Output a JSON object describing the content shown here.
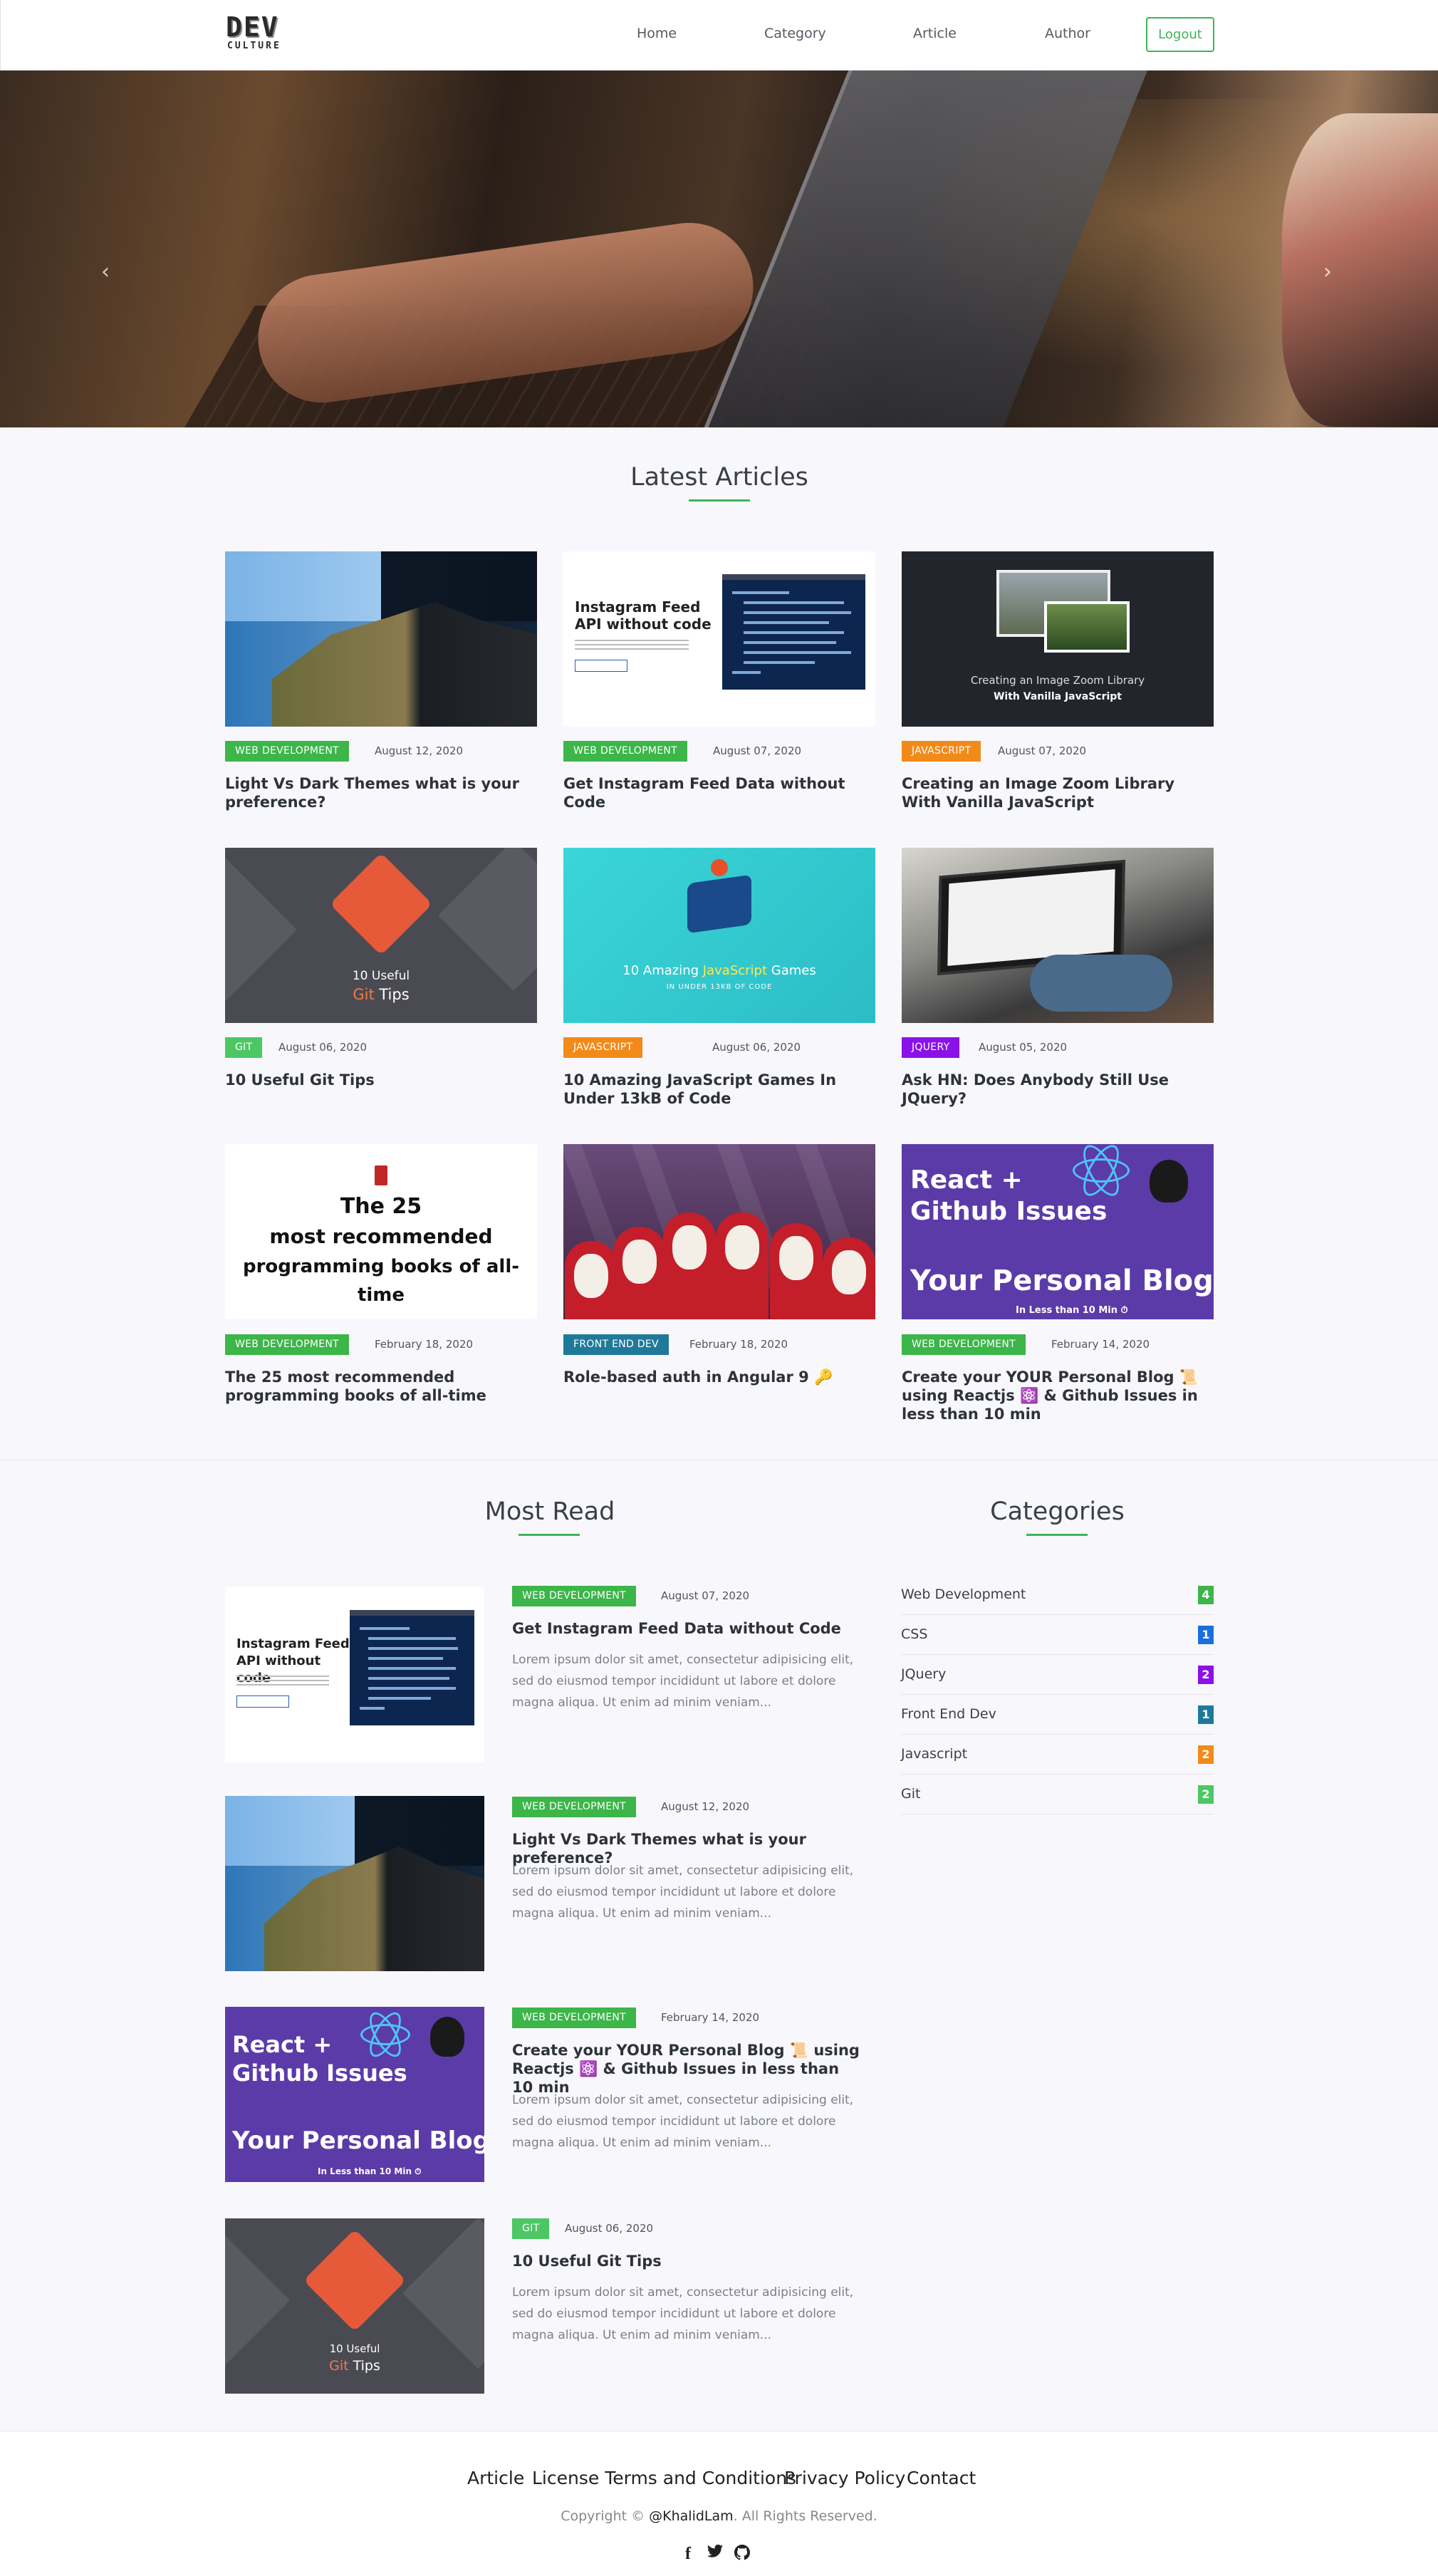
{
  "nav": {
    "logo_top": "DEV",
    "logo_bottom": "CULTURE",
    "links": [
      "Home",
      "Category",
      "Article",
      "Author"
    ],
    "logout": "Logout"
  },
  "hero": {
    "prev": "‹",
    "next": "›"
  },
  "latest": {
    "title": "Latest Articles",
    "articles": [
      {
        "badge": "WEB DEVELOPMENT",
        "badge_color": "#3cb549",
        "date": "August 12, 2020",
        "title": "Light Vs Dark Themes what is your preference?"
      },
      {
        "badge": "WEB DEVELOPMENT",
        "badge_color": "#3cb549",
        "date": "August 07, 2020",
        "title": "Get Instagram Feed Data without Code",
        "thumb_title": "Instagram Feed API without code"
      },
      {
        "badge": "JAVASCRIPT",
        "badge_color": "#f28a1a",
        "date": "August 07, 2020",
        "title": "Creating an Image Zoom Library With Vanilla JavaScript",
        "thumb_line1": "Creating an Image Zoom Library",
        "thumb_line2": "With Vanilla JavaScript"
      },
      {
        "badge": "GIT",
        "badge_color": "#4cc764",
        "date": "August 06, 2020",
        "title": "10 Useful Git Tips",
        "thumb_line1": "10 Useful",
        "thumb_line2a": "Git",
        "thumb_line2b": " Tips"
      },
      {
        "badge": "JAVASCRIPT",
        "badge_color": "#f28a1a",
        "date": "August 06, 2020",
        "title": "10 Amazing JavaScript Games In Under 13kB of Code",
        "thumb_line1a": "10 Amazing ",
        "thumb_line1b": "JavaScript",
        "thumb_line1c": " Games",
        "thumb_line2": "IN UNDER 13KB OF CODE"
      },
      {
        "badge": "JQUERY",
        "badge_color": "#8a12e8",
        "date": "August 05, 2020",
        "title": "Ask HN: Does Anybody Still Use JQuery?"
      },
      {
        "badge": "WEB DEVELOPMENT",
        "badge_color": "#3cb549",
        "date": "February 18, 2020",
        "title": "The 25 most recommended programming books of all-time",
        "thumb_line1": "The 25",
        "thumb_line2": "most recommended",
        "thumb_line3": "programming books of all-time"
      },
      {
        "badge": "FRONT END DEV",
        "badge_color": "#1f7a9a",
        "date": "February 18, 2020",
        "title": "Role-based auth in Angular 9 🔑"
      },
      {
        "badge": "WEB DEVELOPMENT",
        "badge_color": "#3cb549",
        "date": "February 14, 2020",
        "title": "Create your YOUR Personal Blog 📜 using Reactjs ⚛️ & Github Issues in less than 10 min",
        "thumb_line1": "React +",
        "thumb_line2": "Github Issues",
        "thumb_line3": "Your Personal Blog🔥",
        "thumb_line4": "In Less than 10 Min ⏱"
      }
    ]
  },
  "most_read": {
    "title": "Most Read",
    "items": [
      {
        "badge": "WEB DEVELOPMENT",
        "badge_color": "#3cb549",
        "date": "August 07, 2020",
        "title": "Get Instagram Feed Data without Code",
        "desc": "Lorem ipsum dolor sit amet, consectetur adipisicing elit, sed do eiusmod tempor incididunt ut labore et dolore magna aliqua. Ut enim ad minim veniam...",
        "thumb_title": "Instagram Feed API without code"
      },
      {
        "badge": "WEB DEVELOPMENT",
        "badge_color": "#3cb549",
        "date": "August 12, 2020",
        "title": "Light Vs Dark Themes what is your preference?",
        "desc": "Lorem ipsum dolor sit amet, consectetur adipisicing elit, sed do eiusmod tempor incididunt ut labore et dolore magna aliqua. Ut enim ad minim veniam..."
      },
      {
        "badge": "WEB DEVELOPMENT",
        "badge_color": "#3cb549",
        "date": "February 14, 2020",
        "title": "Create your YOUR Personal Blog 📜 using Reactjs ⚛️ & Github Issues in less than 10 min",
        "desc": "Lorem ipsum dolor sit amet, consectetur adipisicing elit, sed do eiusmod tempor incididunt ut labore et dolore magna aliqua. Ut enim ad minim veniam...",
        "thumb_line1": "React +",
        "thumb_line2": "Github Issues",
        "thumb_line3": "Your Personal Blog🔥",
        "thumb_line4": "In Less than 10 Min ⏱"
      },
      {
        "badge": "GIT",
        "badge_color": "#4cc764",
        "date": "August 06, 2020",
        "title": "10 Useful Git Tips",
        "desc": "Lorem ipsum dolor sit amet, consectetur adipisicing elit, sed do eiusmod tempor incididunt ut labore et dolore magna aliqua. Ut enim ad minim veniam...",
        "thumb_line1": "10 Useful",
        "thumb_line2a": "Git",
        "thumb_line2b": " Tips"
      }
    ]
  },
  "categories": {
    "title": "Categories",
    "items": [
      {
        "label": "Web Development",
        "count": "4",
        "color": "#3cb549"
      },
      {
        "label": "CSS",
        "count": "1",
        "color": "#1a6fe0"
      },
      {
        "label": "JQuery",
        "count": "2",
        "color": "#8a12e8"
      },
      {
        "label": "Front End Dev",
        "count": "1",
        "color": "#1f7a9a"
      },
      {
        "label": "Javascript",
        "count": "2",
        "color": "#f28a1a"
      },
      {
        "label": "Git",
        "count": "2",
        "color": "#4cc764"
      }
    ]
  },
  "footer": {
    "links": [
      "Article",
      "License Terms and Conditions",
      "Privacy Policy",
      "Contact"
    ],
    "copyright_pre": "Copyright © ",
    "copyright_name": "@KhalidLam",
    "copyright_post": ". All Rights Reserved.",
    "social": [
      "facebook-icon",
      "twitter-icon",
      "github-icon"
    ]
  },
  "colors": {
    "accent": "#3cb55a"
  }
}
